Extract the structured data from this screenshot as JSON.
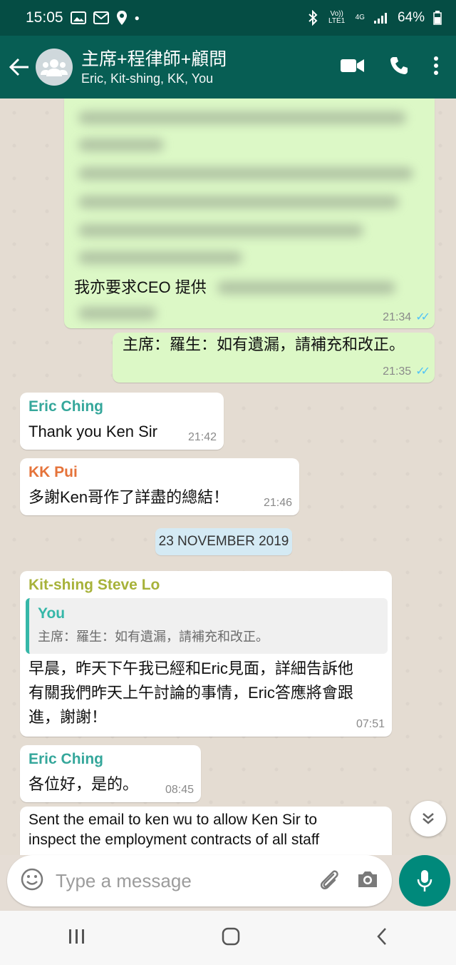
{
  "status_bar": {
    "time": "15:05",
    "network_small": "Vo)) LTE1",
    "network_type": "4G",
    "battery": "64%"
  },
  "header": {
    "title": "主席+程律師+顧問",
    "subtitle": "Eric, Kit-shing, KK, You"
  },
  "messages": {
    "m1": {
      "text": "我亦要求CEO 提供",
      "time": "21:34",
      "ticks": "✓✓"
    },
    "m2": {
      "text": "主席：羅生：如有遺漏，請補充和改正。",
      "time": "21:35",
      "ticks": "✓✓"
    },
    "m3": {
      "sender": "Eric Ching",
      "text": "Thank you Ken Sir",
      "time": "21:42"
    },
    "m4": {
      "sender": "KK Pui",
      "text": "多謝Ken哥作了詳盡的總結！",
      "time": "21:46"
    },
    "date_chip": "23 NOVEMBER 2019",
    "m5": {
      "sender": "Kit-shing Steve Lo",
      "quote_name": "You",
      "quote_text": "主席：羅生：如有遺漏，請補充和改正。",
      "line1": "早晨，昨天下午我已經和Eric見面，詳細告訴他",
      "line2": "有關我們昨天上午討論的事情，Eric答應將會跟",
      "line3": "進，謝謝！",
      "time": "07:51"
    },
    "m6": {
      "sender": "Eric Ching",
      "text": "各位好，是的。",
      "time": "08:45"
    },
    "m7": {
      "line1": "Sent the email to ken wu to allow Ken Sir to",
      "line2": "inspect the employment contracts of all staff"
    }
  },
  "composer": {
    "placeholder": "Type a message"
  },
  "colors": {
    "header": "#075e54",
    "status_bar": "#054d44",
    "outgoing_bubble": "#dcf8c6",
    "incoming_bubble": "#ffffff",
    "accent": "#00897b",
    "eric_name": "#35a79b",
    "kk_name": "#e5733a",
    "steve_name": "#a7b23a",
    "read_ticks": "#4fc3f7"
  },
  "icons": {
    "back": "back-arrow-icon",
    "avatar": "group-icon",
    "video": "video-call-icon",
    "call": "phone-icon",
    "menu": "more-options-icon",
    "emoji": "emoji-icon",
    "attach": "paperclip-icon",
    "camera": "camera-icon",
    "mic": "mic-icon",
    "scroll": "double-chevron-down-icon"
  }
}
